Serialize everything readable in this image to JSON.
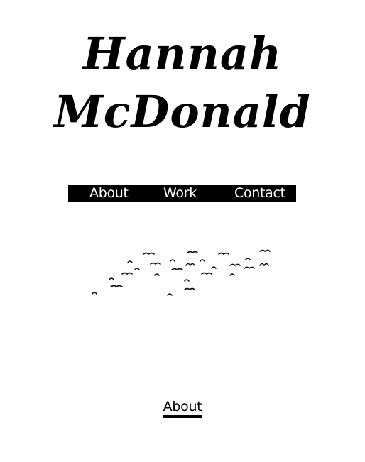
{
  "header": {
    "title_line_1": "Hannah",
    "title_line_2": "McDonald"
  },
  "nav": {
    "items": [
      {
        "label": "About"
      },
      {
        "label": "Work"
      },
      {
        "label": "Contact"
      }
    ],
    "background": "#000000",
    "text_color": "#ffffff"
  },
  "hero": {
    "image": "flock-of-birds-illustration"
  },
  "section": {
    "heading": "About"
  }
}
